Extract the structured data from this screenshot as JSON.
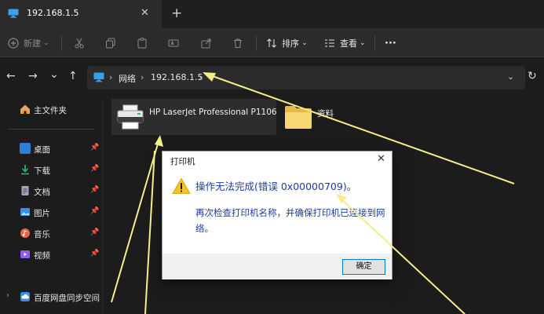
{
  "tab": {
    "title": "192.168.1.5",
    "close_glyph": "✕",
    "icon": "monitor-icon"
  },
  "new_tab_glyph": "+",
  "toolbar": {
    "new_label": "新建",
    "sort_label": "排序",
    "view_label": "查看",
    "more_glyph": "···"
  },
  "nav": {
    "back": "←",
    "forward": "→",
    "recent": "⌄",
    "up": "↑",
    "refresh": "↻"
  },
  "address": {
    "crumbs": [
      "网络",
      "192.168.1.5"
    ],
    "separator": "›",
    "dropdown": "⌄"
  },
  "sidebar": {
    "home_label": "主文件夹",
    "items": [
      {
        "label": "桌面",
        "icon": "desktop-icon",
        "color": "#2d7fd1"
      },
      {
        "label": "下载",
        "icon": "download-icon",
        "color": "#2bb673"
      },
      {
        "label": "文档",
        "icon": "documents-icon",
        "color": "#a0a8b8"
      },
      {
        "label": "图片",
        "icon": "pictures-icon",
        "color": "#3a8ee6"
      },
      {
        "label": "音乐",
        "icon": "music-icon",
        "color": "#e8674a"
      },
      {
        "label": "视频",
        "icon": "videos-icon",
        "color": "#8b5cf6"
      }
    ],
    "pin_glyph": "📌",
    "cloud_label": "百度网盘同步空间"
  },
  "content": {
    "printer_name": "HP LaserJet Professional P1106",
    "folder_name": "资料"
  },
  "dialog": {
    "title": "打印机",
    "close_glyph": "✕",
    "message": "操作无法完成(错误 0x00000709)。",
    "detail": "再次检查打印机名称，并确保打印机已连接到网络。",
    "ok_label": "确定"
  },
  "colors": {
    "accent": "#0078d4",
    "arrow": "#f4ee8a",
    "dialog_text": "#1f3c9c",
    "warning": "#f5c518"
  }
}
